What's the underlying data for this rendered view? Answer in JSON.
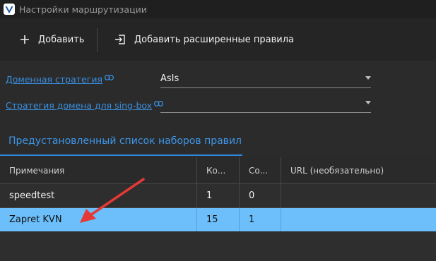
{
  "window": {
    "title": "Настройки маршрутизации"
  },
  "toolbar": {
    "add_label": "Добавить",
    "add_advanced_label": "Добавить расширенные правила"
  },
  "form": {
    "domain_strategy": {
      "label": "Доменная стратегия",
      "value": "AsIs"
    },
    "singbox_strategy": {
      "label": "Стратегия домена для sing-box",
      "value": ""
    }
  },
  "tab": {
    "label": "Предустановленный список наборов правил"
  },
  "table": {
    "headers": [
      "Примечания",
      "Ко...",
      "Со...",
      "URL (необязательно)"
    ],
    "rows": [
      [
        "speedtest",
        "1",
        "0",
        ""
      ],
      [
        "Zapret KVN",
        "15",
        "1",
        ""
      ]
    ]
  },
  "colors": {
    "accent": "#2f86dc",
    "link": "#3a8fe0",
    "selected_row": "#6cbffa",
    "annotation_arrow": "#e53935"
  }
}
